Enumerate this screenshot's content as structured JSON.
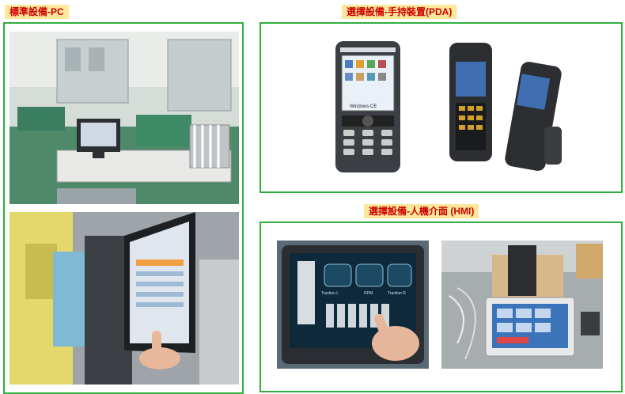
{
  "sections": {
    "pc": {
      "label": "標準設備-PC"
    },
    "pda": {
      "label": "選擇設備-手持裝置(PDA)"
    },
    "hmi": {
      "label": "選擇設備-人機介面 (HMI)"
    }
  },
  "photo_text": {
    "pda_phone_brand": "Windows CE",
    "hmi_tile_1": "Traction L",
    "hmi_tile_2": "RPM",
    "hmi_tile_3": "Traction R"
  },
  "colors": {
    "label_bg": "#fde79a",
    "label_text": "#cc0000",
    "panel_border": "#2fae3f"
  }
}
